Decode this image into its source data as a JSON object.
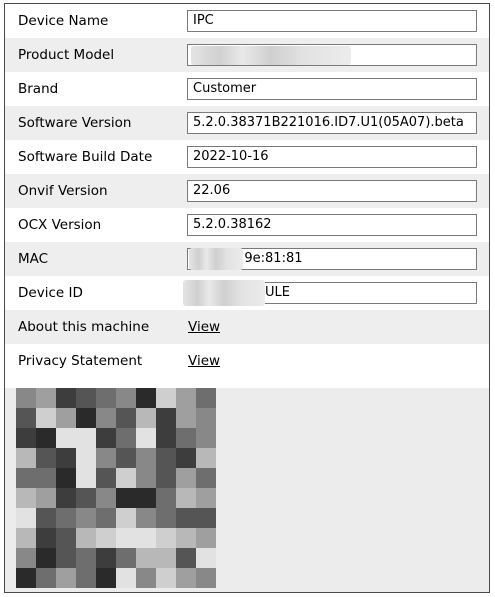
{
  "rows": [
    {
      "label": "Device Name",
      "value": "IPC"
    },
    {
      "label": "Product Model",
      "value": ""
    },
    {
      "label": "Brand",
      "value": "Customer"
    },
    {
      "label": "Software Version",
      "value": "5.2.0.38371B221016.ID7.U1(05A07).beta"
    },
    {
      "label": "Software Build Date",
      "value": "2022-10-16"
    },
    {
      "label": "Onvif Version",
      "value": "22.06"
    },
    {
      "label": "OCX Version",
      "value": "5.2.0.38162"
    },
    {
      "label": "MAC",
      "value": ":9e:81:81"
    },
    {
      "label": "Device ID",
      "value": "ULE"
    }
  ],
  "about": {
    "label": "About this machine",
    "link": "View"
  },
  "privacy": {
    "label": "Privacy Statement",
    "link": "View"
  },
  "qr_code": {
    "icon": "qr-code-icon",
    "state": "blurred"
  }
}
